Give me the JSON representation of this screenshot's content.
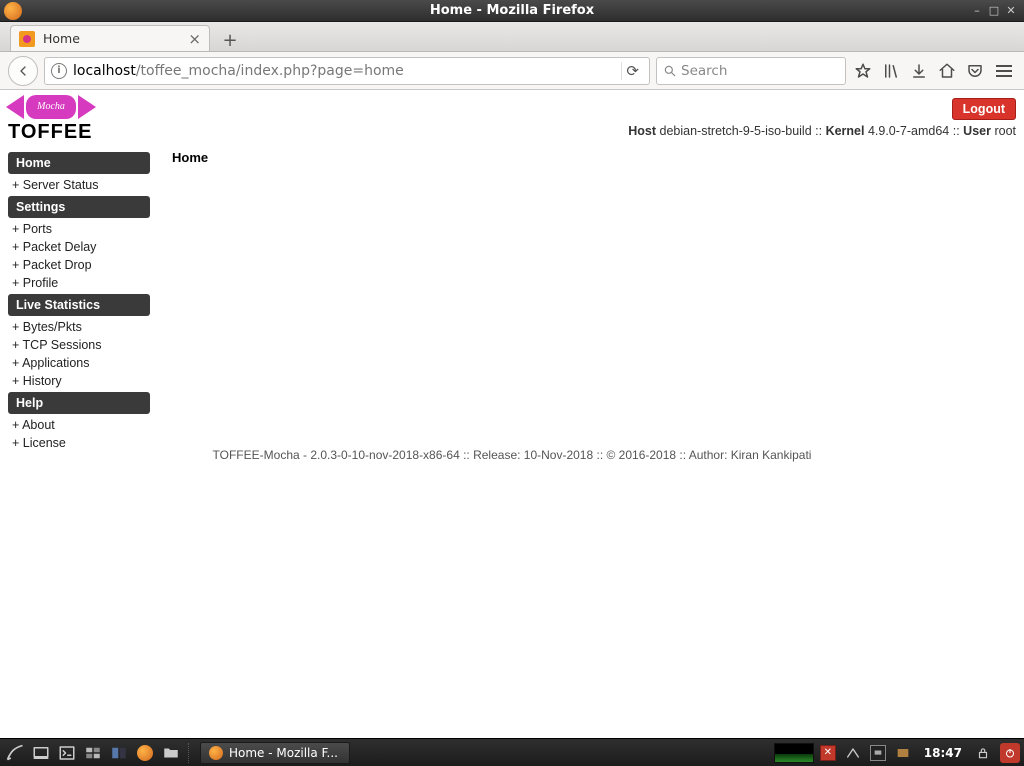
{
  "window": {
    "title": "Home - Mozilla Firefox"
  },
  "browser": {
    "tab_title": "Home",
    "url_host": "localhost",
    "url_path": "/toffee_mocha/index.php?page=home",
    "search_placeholder": "Search"
  },
  "app": {
    "logo_small": "Mocha",
    "logo_big": "TOFFEE",
    "logout": "Logout",
    "host_label": "Host",
    "host_value": "debian-stretch-9-5-iso-build",
    "kernel_label": "Kernel",
    "kernel_value": "4.9.0-7-amd64",
    "user_label": "User",
    "user_value": "root",
    "sidebar": {
      "sections": [
        {
          "header": "Home",
          "items": [
            "Server Status"
          ]
        },
        {
          "header": "Settings",
          "items": [
            "Ports",
            "Packet Delay",
            "Packet Drop",
            "Profile"
          ]
        },
        {
          "header": "Live Statistics",
          "items": [
            "Bytes/Pkts",
            "TCP Sessions",
            "Applications",
            "History"
          ]
        },
        {
          "header": "Help",
          "items": [
            "About",
            "License"
          ]
        }
      ]
    },
    "page_title": "Home",
    "footer": "TOFFEE-Mocha - 2.0.3-0-10-nov-2018-x86-64 :: Release: 10-Nov-2018 :: © 2016-2018 :: Author: Kiran Kankipati"
  },
  "taskbar": {
    "active_window": "Home - Mozilla F...",
    "clock": "18:47"
  }
}
